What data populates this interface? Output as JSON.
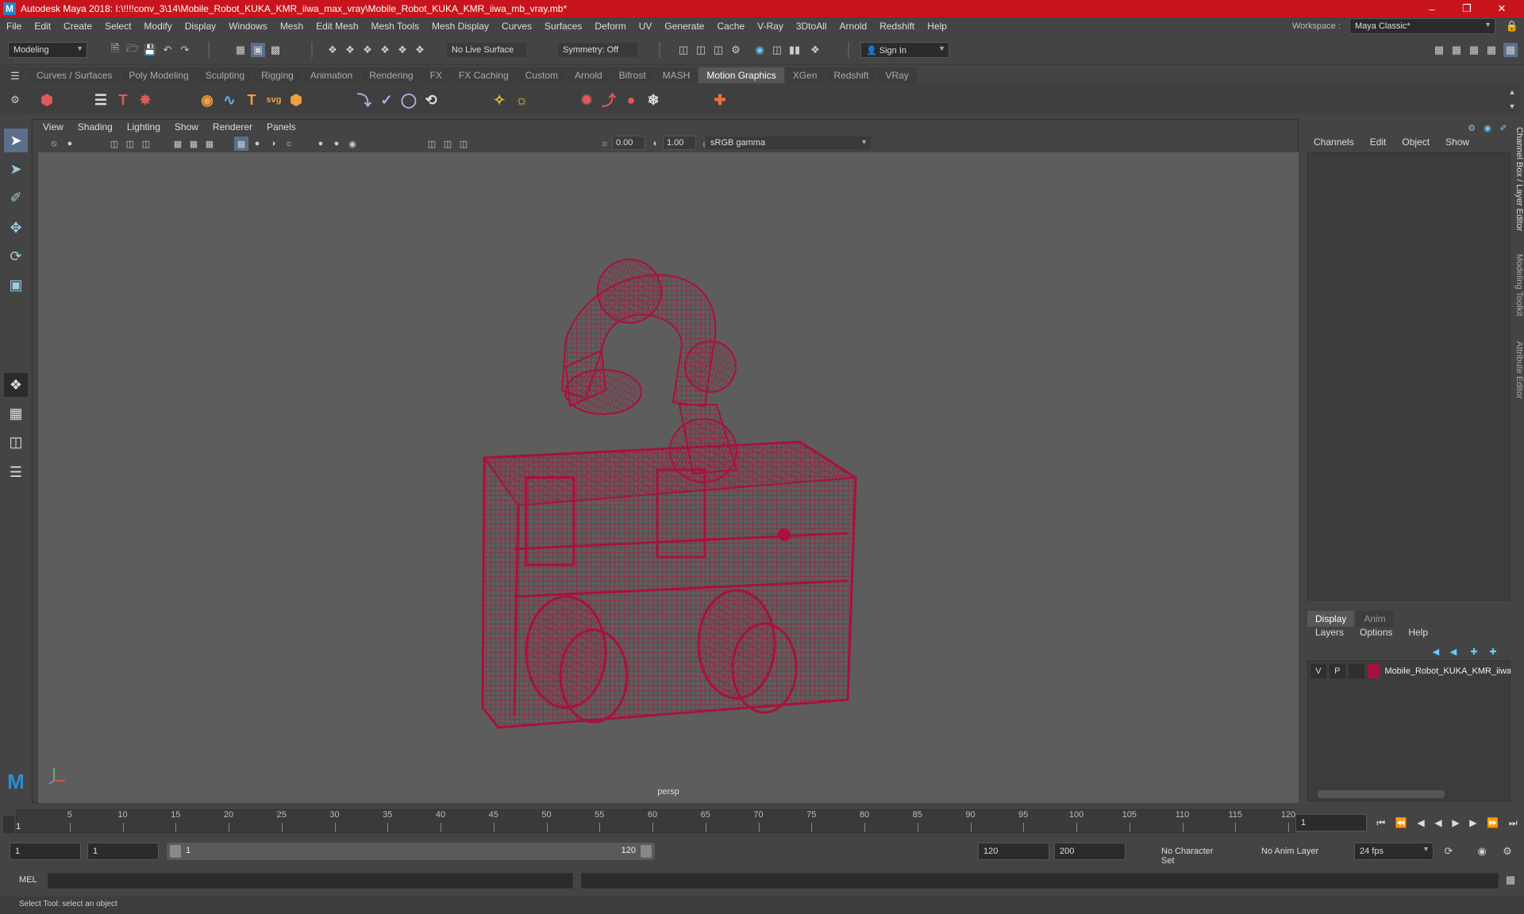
{
  "window": {
    "title": "Autodesk Maya 2018: I:\\!!!!conv_3\\14\\Mobile_Robot_KUKA_KMR_iiwa_max_vray\\Mobile_Robot_KUKA_KMR_iiwa_mb_vray.mb*"
  },
  "menu": [
    "File",
    "Edit",
    "Create",
    "Select",
    "Modify",
    "Display",
    "Windows",
    "Mesh",
    "Edit Mesh",
    "Mesh Tools",
    "Mesh Display",
    "Curves",
    "Surfaces",
    "Deform",
    "UV",
    "Generate",
    "Cache",
    "V-Ray",
    "3DtoAll",
    "Arnold",
    "Redshift",
    "Help"
  ],
  "workspace": {
    "label": "Workspace :",
    "value": "Maya Classic*"
  },
  "toolbar": {
    "mode": "Modeling",
    "live_surface": "No Live Surface",
    "symmetry": "Symmetry: Off",
    "sign_in": "Sign In"
  },
  "shelf_tabs": [
    "Curves / Surfaces",
    "Poly Modeling",
    "Sculpting",
    "Rigging",
    "Animation",
    "Rendering",
    "FX",
    "FX Caching",
    "Custom",
    "Arnold",
    "Bifrost",
    "MASH",
    "Motion Graphics",
    "XGen",
    "Redshift",
    "VRay"
  ],
  "active_shelf_tab": "Motion Graphics",
  "viewport": {
    "menu": [
      "View",
      "Shading",
      "Lighting",
      "Show",
      "Renderer",
      "Panels"
    ],
    "exposure": "0.00",
    "gamma": "1.00",
    "color_space": "sRGB gamma",
    "camera": "persp",
    "wire_color": "#a8123a"
  },
  "channel_box": {
    "menu": [
      "Channels",
      "Edit",
      "Object",
      "Show"
    ]
  },
  "layer_editor": {
    "tabs": [
      "Display",
      "Anim"
    ],
    "active_tab": "Display",
    "menu": [
      "Layers",
      "Options",
      "Help"
    ],
    "layer": {
      "v": "V",
      "p": "P",
      "name": "Mobile_Robot_KUKA_KMR_iiwa",
      "color": "#a8123a"
    }
  },
  "side_tabs": [
    "Channel Box / Layer Editor",
    "Modeling Toolkit",
    "Attribute Editor"
  ],
  "timeline": {
    "ticks": [
      5,
      10,
      15,
      20,
      25,
      30,
      35,
      40,
      45,
      50,
      55,
      60,
      65,
      70,
      75,
      80,
      85,
      90,
      95,
      100,
      105,
      110,
      115,
      120
    ],
    "current_frame": "1",
    "current_field": "1"
  },
  "range": {
    "start": "1",
    "start2": "1",
    "slider_start": "1",
    "slider_end": "120",
    "end": "120",
    "end2": "200",
    "character_set": "No Character Set",
    "anim_layer": "No Anim Layer",
    "fps": "24 fps"
  },
  "cmdline": {
    "label": "MEL"
  },
  "status": {
    "text": "Select Tool: select an object"
  }
}
